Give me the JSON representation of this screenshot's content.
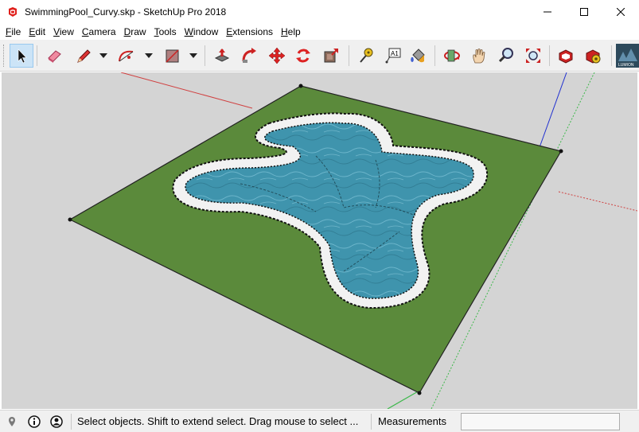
{
  "window": {
    "title": "SwimmingPool_Curvy.skp - SketchUp Pro 2018",
    "minimize_glyph": "─",
    "maximize_glyph": "☐",
    "close_glyph": "✕"
  },
  "menu": [
    {
      "label": "File",
      "key": "F",
      "rest": "ile"
    },
    {
      "label": "Edit",
      "key": "E",
      "rest": "dit"
    },
    {
      "label": "View",
      "key": "V",
      "rest": "iew"
    },
    {
      "label": "Camera",
      "key": "C",
      "rest": "amera"
    },
    {
      "label": "Draw",
      "key": "D",
      "rest": "raw"
    },
    {
      "label": "Tools",
      "key": "T",
      "rest": "ools"
    },
    {
      "label": "Window",
      "key": "W",
      "rest": "indow"
    },
    {
      "label": "Extensions",
      "key": "E",
      "rest": "xtensions"
    },
    {
      "label": "Help",
      "key": "H",
      "rest": "elp"
    }
  ],
  "toolbar": {
    "tools": [
      "select-icon",
      "eraser-icon",
      "pencil-line-icon",
      "arc-icon",
      "rectangle-icon",
      "push-pull-icon",
      "follow-me-icon",
      "move-icon",
      "rotate-icon",
      "offset-icon",
      "tape-measure-icon",
      "text-label-icon",
      "paint-bucket-icon",
      "orbit-icon",
      "pan-icon",
      "zoom-icon",
      "zoom-extents-icon",
      "warehouse-icon",
      "extension-warehouse-icon",
      "lumion-icon"
    ],
    "text_tool_glyph": "A1",
    "lumion_label": "LUMION"
  },
  "status": {
    "message": "Select objects. Shift to extend select. Drag mouse to select ...",
    "measurements_label": "Measurements",
    "measurements_value": ""
  },
  "colors": {
    "viewport_bg": "#d4d4d4",
    "grass": "#5b8a3b",
    "coping": "#f2f2f2",
    "water": "#3e93ad",
    "axis_red": "#d04040",
    "axis_green": "#3cb84a",
    "axis_blue": "#2030d0"
  }
}
